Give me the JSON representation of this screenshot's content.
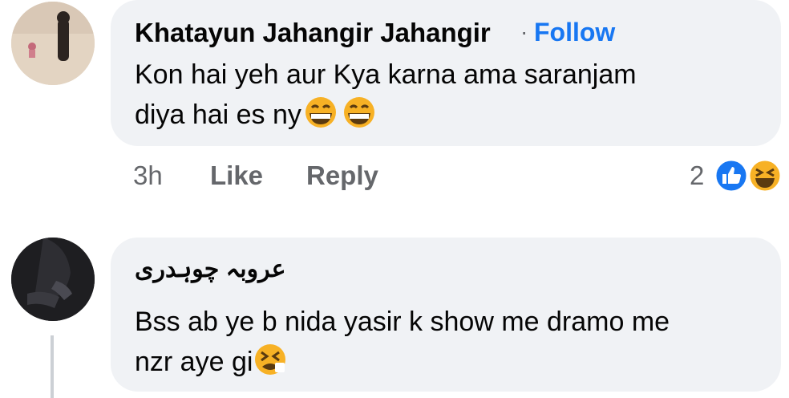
{
  "comments": [
    {
      "author": "Khatayun Jahangir Jahangir",
      "separator": "·",
      "follow_label": "Follow",
      "text_line1": "Kon hai yeh aur Kya karna ama saranjam",
      "text_line2": "diya hai es ny",
      "emojis": [
        "grinning-face-icon",
        "grinning-face-icon"
      ],
      "time": "3h",
      "like_label": "Like",
      "reply_label": "Reply",
      "reaction_count": "2",
      "reactions": [
        "like-icon",
        "laughing-face-icon"
      ]
    },
    {
      "author": "عروبہ چوہدری",
      "text_line1": "Bss ab ye b nida yasir k show me dramo me",
      "text_line2": "nzr aye gi",
      "emojis": [
        "tired-face-icon"
      ]
    }
  ],
  "colors": {
    "bubble": "#f0f2f5",
    "follow": "#1877f2",
    "meta": "#65676b",
    "like": "#1877f2",
    "emoji": "#f7b125"
  }
}
